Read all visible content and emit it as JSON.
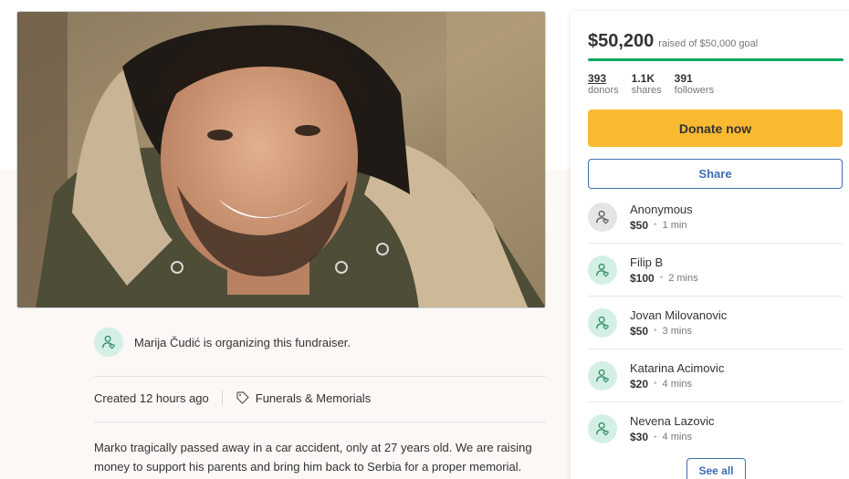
{
  "hero": {
    "image_alt": "Photo of a smiling young man in a dark parka with a fur-trimmed hood"
  },
  "organizer": {
    "text": "Marija Čudić is organizing this fundraiser."
  },
  "meta": {
    "created": "Created 12 hours ago",
    "category": "Funerals & Memorials"
  },
  "story": {
    "text": "Marko tragically passed away in a car accident, only at 27 years old. We are raising money to support his parents and bring him back to Serbia for a proper memorial."
  },
  "sidebar": {
    "raised_amount": "$50,200",
    "raised_goal": "raised of $50,000 goal",
    "progress_percent": 100,
    "stats": [
      {
        "value": "393",
        "label": "donors"
      },
      {
        "value": "1.1K",
        "label": "shares"
      },
      {
        "value": "391",
        "label": "followers"
      }
    ],
    "donate_label": "Donate now",
    "share_label": "Share",
    "see_all_label": "See all",
    "donations": [
      {
        "name": "Anonymous",
        "amount": "$50",
        "time": "1 min"
      },
      {
        "name": "Filip B",
        "amount": "$100",
        "time": "2 mins"
      },
      {
        "name": "Jovan Milovanovic",
        "amount": "$50",
        "time": "3 mins"
      },
      {
        "name": "Katarina Acimovic",
        "amount": "$20",
        "time": "4 mins"
      },
      {
        "name": "Nevena Lazovic",
        "amount": "$30",
        "time": "4 mins"
      }
    ]
  },
  "colors": {
    "donate_button": "#f9b931",
    "progress": "#02a95c",
    "share_border": "#3d6eb4",
    "avatar_green": "#d4f0e6"
  }
}
